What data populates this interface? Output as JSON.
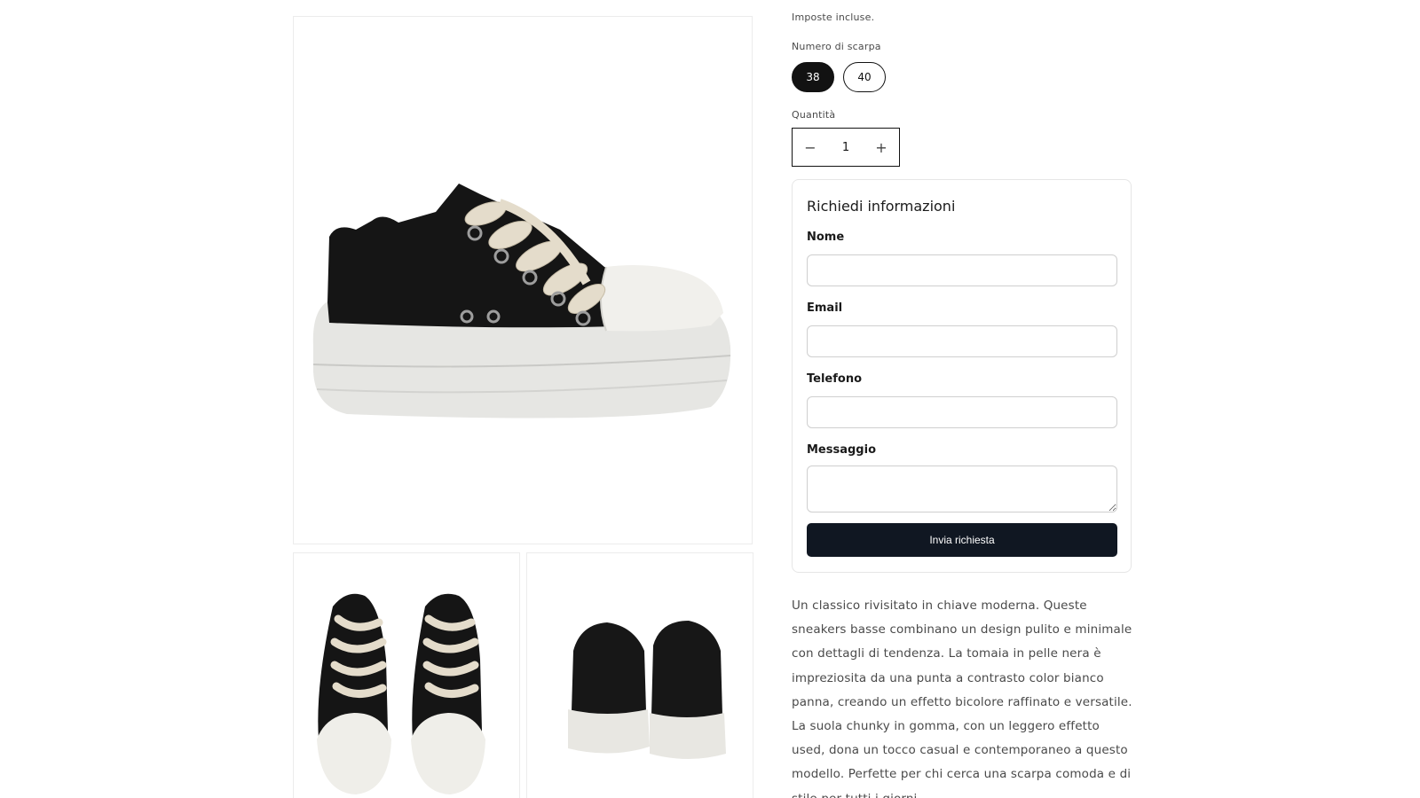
{
  "product": {
    "tax_note": "Imposte incluse.",
    "size_label": "Numero di scarpa",
    "sizes": [
      {
        "label": "38",
        "selected": true
      },
      {
        "label": "40",
        "selected": false
      }
    ],
    "quantity_label": "Quantità",
    "quantity_value": "1",
    "decrease_symbol": "−",
    "increase_symbol": "+",
    "description": "Un classico rivisitato in chiave moderna. Queste sneakers basse combinano un design pulito e minimale con dettagli di tendenza. La tomaia in pelle nera è impreziosita da una punta a contrasto color bianco panna, creando un effetto bicolore raffinato e versatile. La suola chunky in gomma, con un leggero effetto used, dona un tocco casual e contemporaneo a questo modello. Perfette per chi cerca una scarpa comoda e di stile per tutti i giorni."
  },
  "inquiry": {
    "title": "Richiedi informazioni",
    "fields": [
      {
        "label": "Nome",
        "value": ""
      },
      {
        "label": "Email",
        "value": ""
      },
      {
        "label": "Telefono",
        "value": ""
      },
      {
        "label": "Messaggio",
        "value": ""
      }
    ],
    "submit_label": "Invia richiesta"
  },
  "colors": {
    "primary": "#121212",
    "button_dark": "#101722",
    "border": "#cfcfcf",
    "text_muted": "#4a4a4a"
  },
  "gallery": {
    "images": [
      "sneaker-side-view",
      "sneaker-front-pair",
      "sneaker-back-pair"
    ]
  }
}
